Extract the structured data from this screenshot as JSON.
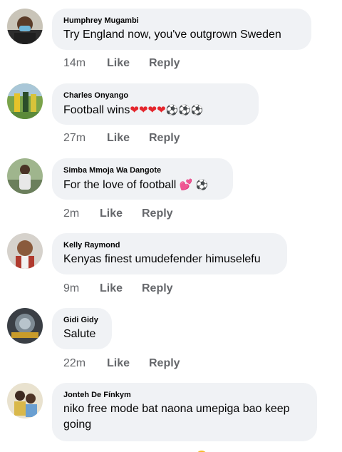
{
  "comments": [
    {
      "author": "Humphrey Mugambi",
      "text": "Try England now,  you've outgrown Sweden",
      "time": "14m",
      "like": "Like",
      "reply": "Reply"
    },
    {
      "author": "Charles Onyango",
      "text": "Football wins",
      "emojis": [
        "heart",
        "heart",
        "heart",
        "heart",
        "soccer-ball",
        "soccer-ball",
        "soccer-ball"
      ],
      "time": "27m",
      "like": "Like",
      "reply": "Reply"
    },
    {
      "author": "Simba Mmoja Wa Dangote",
      "text": "For the love of football",
      "emojis": [
        "love-hearts",
        "soccer-ball"
      ],
      "time": "2m",
      "like": "Like",
      "reply": "Reply"
    },
    {
      "author": "Kelly Raymond",
      "text": "Kenyas finest umudefender himuselefu",
      "time": "9m",
      "like": "Like",
      "reply": "Reply"
    },
    {
      "author": "Gidi Gidy",
      "text": "Salute",
      "time": "22m",
      "like": "Like",
      "reply": "Reply"
    },
    {
      "author": "Jonteh De Fínkym",
      "text": "niko free mode bat naona umepiga bao keep going",
      "time": "",
      "like": "",
      "reply": ""
    }
  ],
  "colors": {
    "bubble": "#f0f2f5",
    "meta": "#65676b",
    "text": "#050505",
    "heart": "#e4262d"
  }
}
